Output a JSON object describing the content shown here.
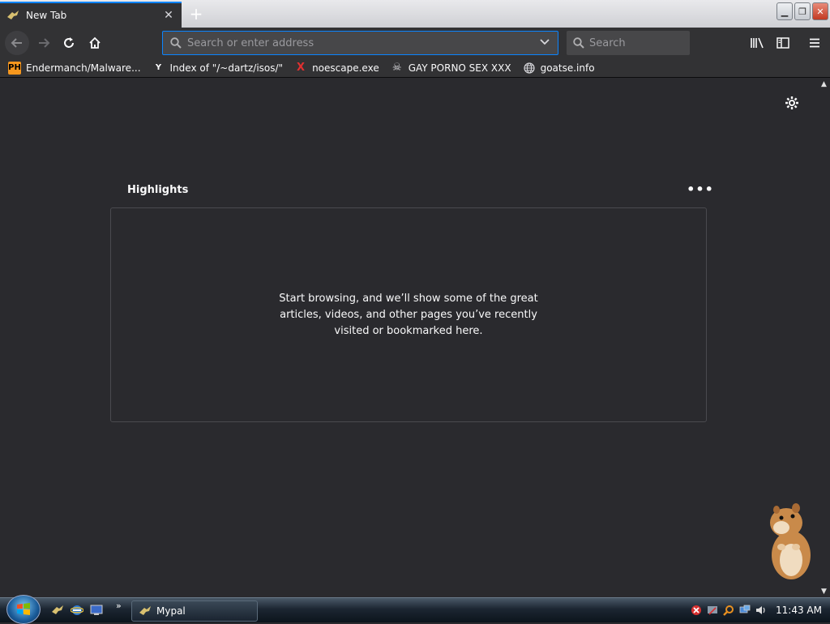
{
  "tab": {
    "title": "New Tab",
    "icon": "mypal-favicon-icon"
  },
  "window": {
    "minimize": "minimize-icon",
    "restore": "restore-icon",
    "close": "close-icon"
  },
  "navbar": {
    "url_placeholder": "Search or enter address",
    "search_placeholder": "Search"
  },
  "bookmarks": [
    {
      "label": "Endermanch/Malware...",
      "icon_text": "PH",
      "icon_bg": "#f7971d",
      "icon_color": "#000000"
    },
    {
      "label": "Index of \"/~dartz/isos/\"",
      "icon_text": "Y",
      "icon_bg": "#323234",
      "icon_color": "#f9f9fa"
    },
    {
      "label": "noescape.exe",
      "icon_text": "X",
      "icon_bg": "#323234",
      "icon_color": "#e03030"
    },
    {
      "label": "GAY PORNO SEX XXX",
      "icon_text": "☠",
      "icon_bg": "#323234",
      "icon_color": "#d7d7db"
    },
    {
      "label": "goatse.info",
      "icon_text": "🌐",
      "icon_bg": "#323234",
      "icon_color": "#d7d7db"
    }
  ],
  "content": {
    "highlights_title": "Highlights",
    "empty_message": "Start browsing, and we’ll show some of the great articles, videos, and other pages you’ve recently visited or bookmarked here."
  },
  "taskbar": {
    "task_label": "Mypal",
    "clock": "11:43 AM"
  },
  "colors": {
    "accent": "#0a84ff",
    "background": "#2a2a2e",
    "toolbar": "#323234"
  }
}
